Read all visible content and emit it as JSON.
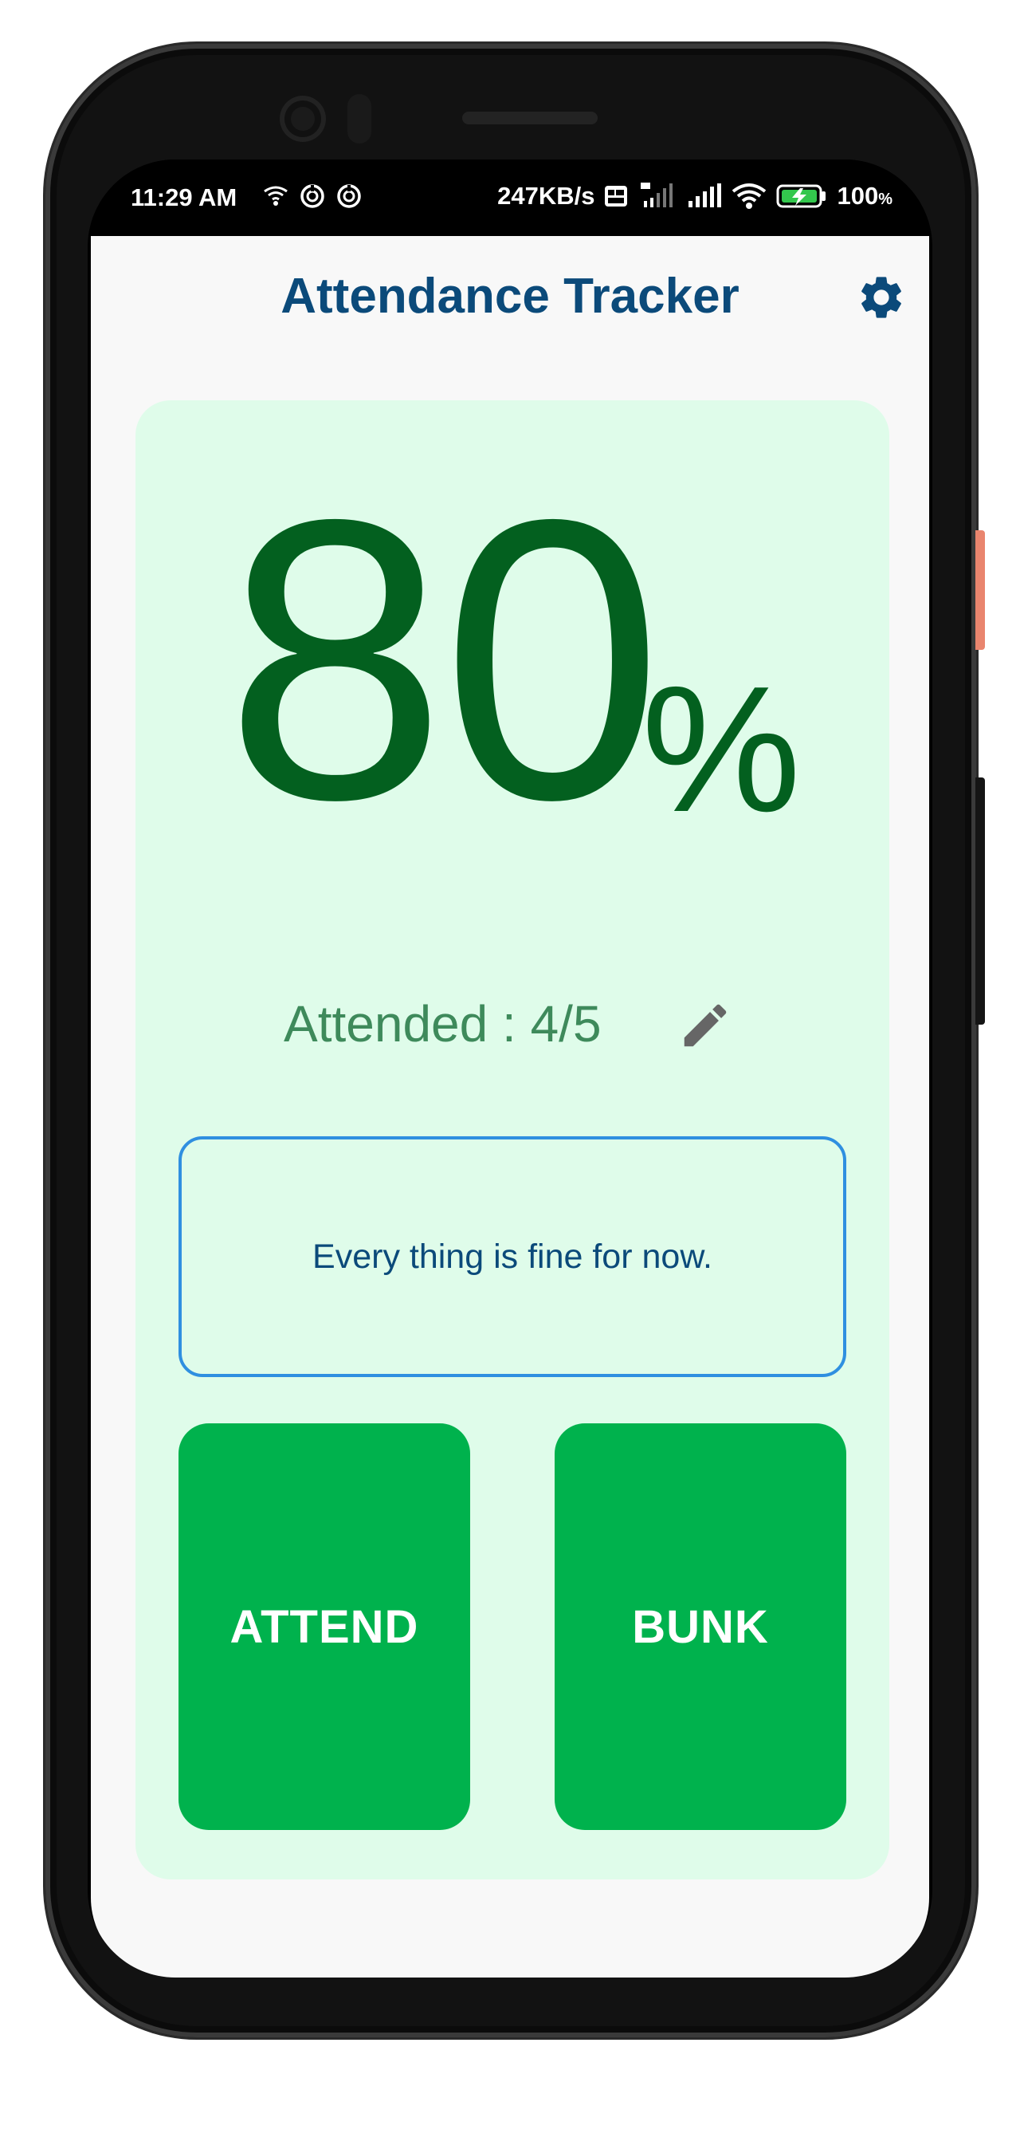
{
  "status_bar": {
    "time": "11:29 AM",
    "network_speed": "247KB/s",
    "battery_level": "100",
    "battery_unit": "%",
    "left_icons": [
      "wifi-hotspot-icon",
      "sync-icon",
      "sync-icon"
    ],
    "right_icons": [
      "volte-icon",
      "4g-signal-icon",
      "signal-icon",
      "wifi-icon",
      "battery-charging-icon"
    ]
  },
  "header": {
    "title": "Attendance Tracker",
    "settings_icon": "gear-icon"
  },
  "stats": {
    "percentage": "80",
    "percent_symbol": "%",
    "attended_label": "Attended : 4/5",
    "edit_icon": "pencil-icon"
  },
  "message": {
    "text": "Every thing is fine for now."
  },
  "actions": {
    "attend_label": "ATTEND",
    "bunk_label": "BUNK"
  },
  "colors": {
    "title": "#0b4a7a",
    "card_background": "#dffcea",
    "percentage": "#03601f",
    "attended_text": "#3e8a5b",
    "message_border": "#2f8fe0",
    "button_background": "#00b24d",
    "button_text": "#ffffff"
  }
}
